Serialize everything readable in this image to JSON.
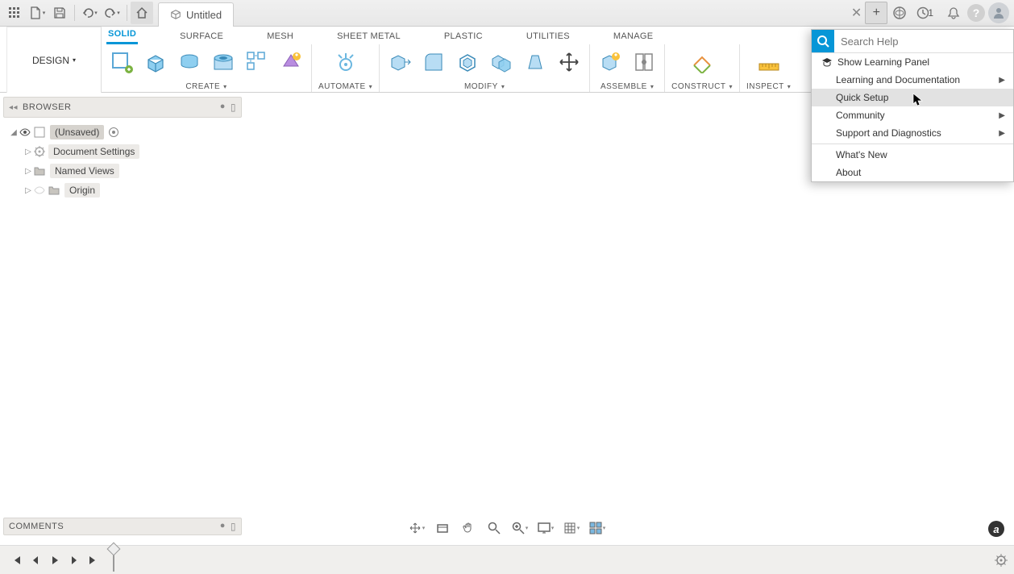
{
  "window": {
    "doc_title": "Untitled",
    "job_count": "1"
  },
  "workspace_button": "DESIGN",
  "ribbon_tabs": [
    "SOLID",
    "SURFACE",
    "MESH",
    "SHEET METAL",
    "PLASTIC",
    "UTILITIES",
    "MANAGE"
  ],
  "ribbon_active_tab": 0,
  "ribbon_groups": {
    "create": "CREATE",
    "automate": "AUTOMATE",
    "modify": "MODIFY",
    "assemble": "ASSEMBLE",
    "construct": "CONSTRUCT",
    "inspect": "INSPECT"
  },
  "browser": {
    "title": "BROWSER",
    "root": "(Unsaved)",
    "items": [
      "Document Settings",
      "Named Views",
      "Origin"
    ]
  },
  "help_menu": {
    "search_placeholder": "Search Help",
    "items": [
      {
        "label": "Show Learning Panel",
        "icon": true,
        "arrow": false
      },
      {
        "label": "Learning and Documentation",
        "arrow": true
      },
      {
        "label": "Quick Setup",
        "arrow": false,
        "highlight": true
      },
      {
        "label": "Community",
        "arrow": true
      },
      {
        "label": "Support and Diagnostics",
        "arrow": true
      }
    ],
    "items2": [
      {
        "label": "What's New"
      },
      {
        "label": "About"
      }
    ]
  },
  "comments": {
    "title": "COMMENTS"
  }
}
